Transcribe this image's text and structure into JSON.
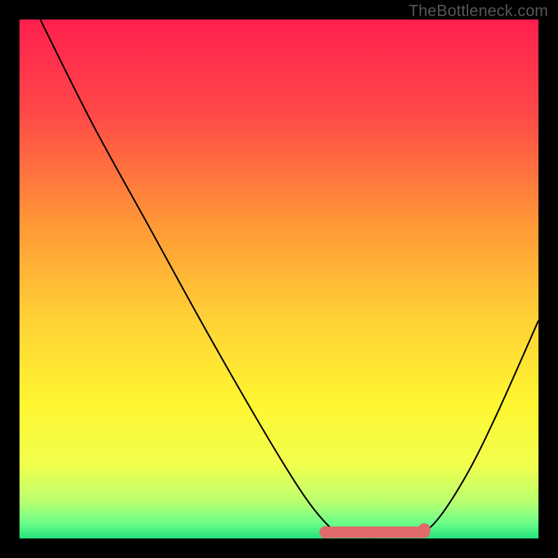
{
  "watermark": "TheBottleneck.com",
  "chart_data": {
    "type": "line",
    "title": "",
    "xlabel": "",
    "ylabel": "",
    "xlim": [
      0,
      100
    ],
    "ylim": [
      0,
      100
    ],
    "background_gradient": {
      "stops": [
        {
          "pct": 0,
          "color": "#ff1f4e"
        },
        {
          "pct": 18,
          "color": "#ff4848"
        },
        {
          "pct": 40,
          "color": "#ff9a36"
        },
        {
          "pct": 58,
          "color": "#ffd236"
        },
        {
          "pct": 74,
          "color": "#fff631"
        },
        {
          "pct": 86,
          "color": "#f0ff4e"
        },
        {
          "pct": 93,
          "color": "#b8ff70"
        },
        {
          "pct": 97,
          "color": "#6dff8a"
        },
        {
          "pct": 100,
          "color": "#23e27a"
        }
      ]
    },
    "series": [
      {
        "name": "bottleneck-curve",
        "stroke": "#000000",
        "points": [
          {
            "x": 4.0,
            "y": 100.0
          },
          {
            "x": 14.0,
            "y": 80.0
          },
          {
            "x": 25.0,
            "y": 60.0
          },
          {
            "x": 36.0,
            "y": 40.0
          },
          {
            "x": 47.5,
            "y": 20.0
          },
          {
            "x": 55.0,
            "y": 8.0
          },
          {
            "x": 60.0,
            "y": 2.0
          },
          {
            "x": 63.0,
            "y": 0.5
          },
          {
            "x": 70.0,
            "y": 0.3
          },
          {
            "x": 76.0,
            "y": 0.8
          },
          {
            "x": 80.0,
            "y": 3.0
          },
          {
            "x": 86.0,
            "y": 12.0
          },
          {
            "x": 92.0,
            "y": 24.0
          },
          {
            "x": 100.0,
            "y": 42.0
          }
        ]
      }
    ],
    "highlight_band": {
      "name": "optimal-range",
      "color": "#e16a6a",
      "x_start": 59,
      "x_end": 78,
      "y": 1.2,
      "thickness": 2.2,
      "end_dots": true
    }
  }
}
